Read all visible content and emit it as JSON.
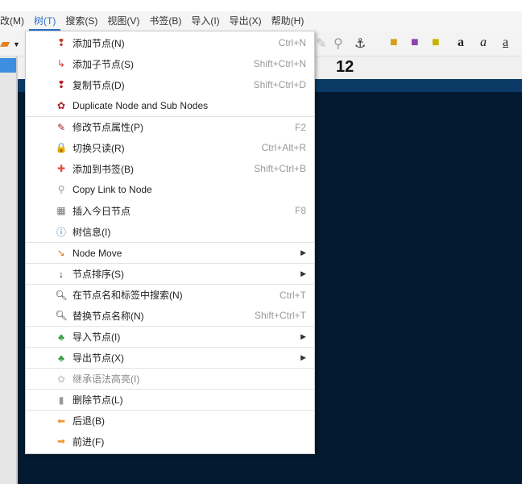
{
  "menubar": [
    "改(M)",
    "树(T)",
    "搜索(S)",
    "视图(V)",
    "书签(B)",
    "导入(I)",
    "导出(X)",
    "帮助(H)"
  ],
  "header": {
    "title": "12"
  },
  "toolbar": {
    "icons": [
      "edit-icon",
      "link-icon",
      "anchor-icon",
      "color-icon",
      "highlight-icon",
      "bg-color-icon"
    ],
    "bold": "a",
    "italic": "a",
    "underline": "a"
  },
  "menu": [
    {
      "label": "添加节点(N)",
      "shortcut": "Ctrl+N",
      "icon": "add-node-icon",
      "glyph": "❢",
      "color": "#c0392b"
    },
    {
      "label": "添加子节点(S)",
      "shortcut": "Shift+Ctrl+N",
      "icon": "add-subnode-icon",
      "glyph": "↳",
      "color": "#c0392b"
    },
    {
      "label": "复制节点(D)",
      "shortcut": "Shift+Ctrl+D",
      "icon": "duplicate-node-icon",
      "glyph": "❢",
      "color": "#b0202a"
    },
    {
      "label": "Duplicate Node and Sub Nodes",
      "shortcut": "",
      "icon": "duplicate-subnodes-icon",
      "glyph": "✿",
      "color": "#b0202a"
    },
    {
      "label": "修改节点属性(P)",
      "shortcut": "F2",
      "icon": "node-properties-icon",
      "glyph": "✎",
      "color": "#a02020",
      "sep": true
    },
    {
      "label": "切换只读(R)",
      "shortcut": "Ctrl+Alt+R",
      "icon": "lock-icon",
      "glyph": "🔒",
      "color": "#d4a017"
    },
    {
      "label": "添加到书签(B)",
      "shortcut": "Shift+Ctrl+B",
      "icon": "bookmark-add-icon",
      "glyph": "✚",
      "color": "#e24a3a"
    },
    {
      "label": "Copy Link to Node",
      "shortcut": "",
      "icon": "copy-link-icon",
      "glyph": "⚲",
      "color": "#999"
    },
    {
      "label": "插入今日节点",
      "shortcut": "F8",
      "icon": "calendar-icon",
      "glyph": "▦",
      "color": "#777"
    },
    {
      "label": "树信息(I)",
      "shortcut": "",
      "icon": "info-icon",
      "glyph": "ⓘ",
      "color": "#2a6fc9"
    },
    {
      "label": "Node Move",
      "shortcut": "",
      "icon": "node-move-icon",
      "glyph": "➘",
      "color": "#e67e22",
      "submenu": true,
      "sep": true
    },
    {
      "label": "节点排序(S)",
      "shortcut": "",
      "icon": "sort-icon",
      "glyph": "↓",
      "color": "#222",
      "submenu": true,
      "sep": true
    },
    {
      "label": "在节点名和标签中搜索(N)",
      "shortcut": "Ctrl+T",
      "icon": "search-icon",
      "glyph": "🔍︎",
      "color": "#333",
      "sep": true
    },
    {
      "label": "替换节点名称(N)",
      "shortcut": "Shift+Ctrl+T",
      "icon": "replace-icon",
      "glyph": "🔍︎",
      "color": "#333"
    },
    {
      "label": "导入节点(I)",
      "shortcut": "",
      "icon": "import-nodes-icon",
      "glyph": "♣",
      "color": "#2e9e3a",
      "submenu": true,
      "sep": true
    },
    {
      "label": "导出节点(X)",
      "shortcut": "",
      "icon": "export-nodes-icon",
      "glyph": "♣",
      "color": "#2e9e3a",
      "submenu": true,
      "sep": true
    },
    {
      "label": "继承语法高亮(I)",
      "shortcut": "",
      "icon": "inherit-syntax-icon",
      "glyph": "✿",
      "color": "#ccc",
      "sep": true
    },
    {
      "label": "删除节点(L)",
      "shortcut": "",
      "icon": "trash-icon",
      "glyph": "▮",
      "color": "#999",
      "sep": true
    },
    {
      "label": "后退(B)",
      "shortcut": "",
      "icon": "back-arrow-icon",
      "glyph": "⬅",
      "color": "#f0952e",
      "sep": true
    },
    {
      "label": "前进(F)",
      "shortcut": "",
      "icon": "forward-arrow-icon",
      "glyph": "➡",
      "color": "#f0952e"
    }
  ]
}
